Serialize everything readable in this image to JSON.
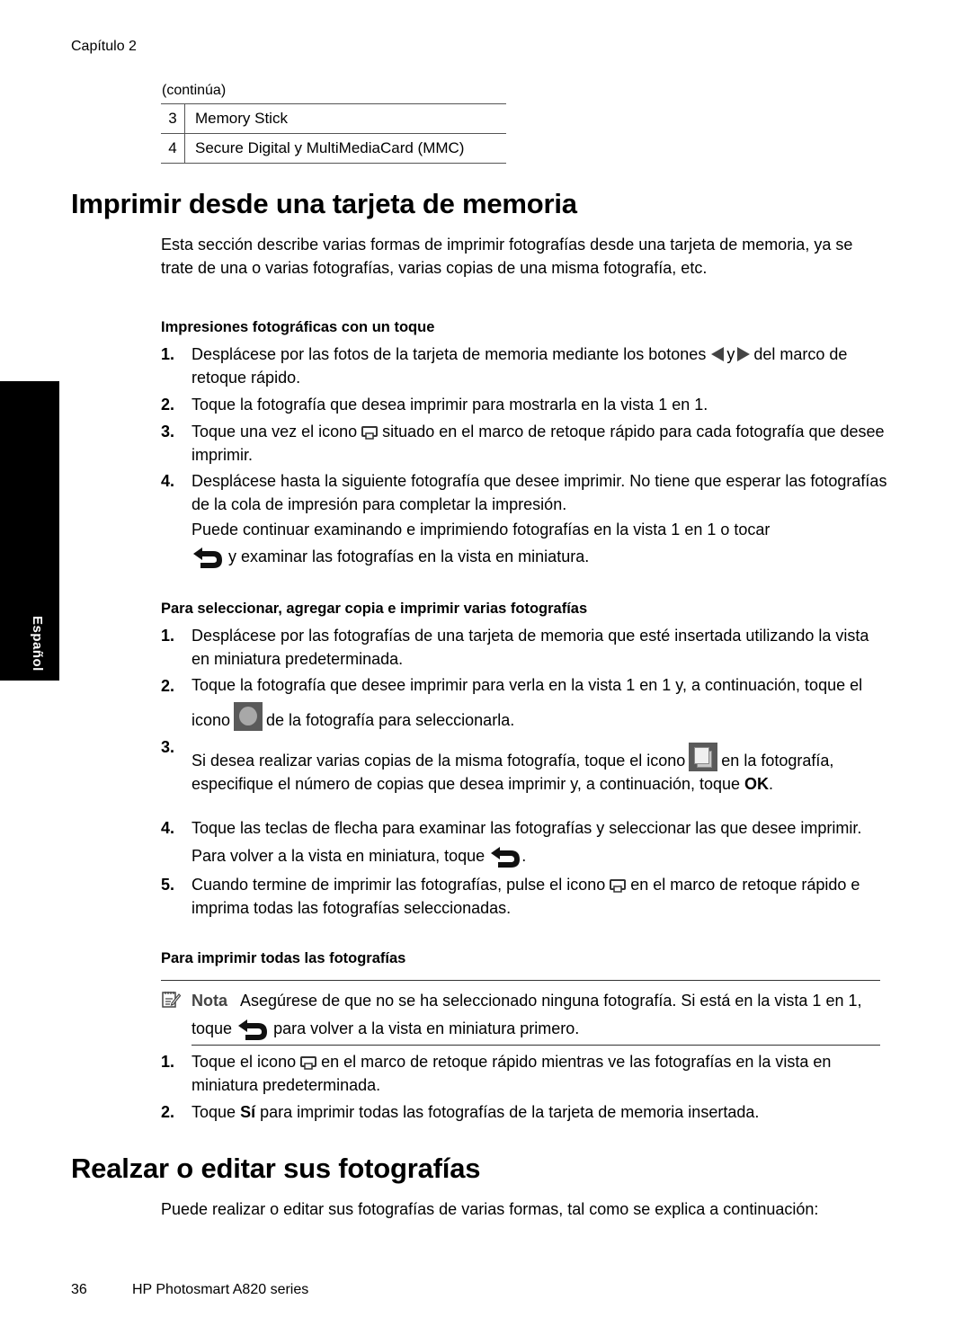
{
  "header": {
    "chapter": "Capítulo 2"
  },
  "table": {
    "continued_label": "(continúa)",
    "rows": [
      {
        "num": "3",
        "text": "Memory Stick"
      },
      {
        "num": "4",
        "text": "Secure Digital y MultiMediaCard (MMC)"
      }
    ]
  },
  "side_tab": {
    "label": "Español"
  },
  "section1": {
    "title": "Imprimir desde una tarjeta de memoria",
    "intro": "Esta sección describe varias formas de imprimir fotografías desde una tarjeta de memoria, ya se trate de una o varias fotografías, varias copias de una misma fotografía, etc.",
    "one_touch": {
      "heading": "Impresiones fotográficas con un toque",
      "steps": [
        {
          "num": "1.",
          "before": "Desplácese por las fotos de la tarjeta de memoria mediante los botones",
          "mid": "y",
          "after": "del marco de retoque rápido.",
          "icons": [
            "left-arrow-icon",
            "right-arrow-icon"
          ]
        },
        {
          "num": "2.",
          "text": "Toque la fotografía que desea imprimir para mostrarla en la vista 1 en 1."
        },
        {
          "num": "3.",
          "before": "Toque una vez el icono",
          "after": "situado en el marco de retoque rápido para cada fotografía que desee imprimir.",
          "icon": "print-icon"
        },
        {
          "num": "4.",
          "text": "Desplácese hasta la siguiente fotografía que desee imprimir. No tiene que esperar las fotografías de la cola de impresión para completar la impresión.",
          "extra_before": "Puede continuar examinando e imprimiendo fotografías en la vista 1 en 1 o tocar",
          "extra_after": "y examinar las fotografías en la vista en miniatura.",
          "icon": "back-icon"
        }
      ]
    },
    "multi": {
      "heading": "Para seleccionar, agregar copia e imprimir varias fotografías",
      "steps": [
        {
          "num": "1.",
          "text": "Desplácese por las fotografías de una tarjeta de memoria que esté insertada utilizando la vista en miniatura predeterminada."
        },
        {
          "num": "2.",
          "before": "Toque la fotografía que desee imprimir para verla en la vista 1 en 1 y, a continuación, toque el icono",
          "after": "de la fotografía para seleccionarla.",
          "icon": "select-icon"
        },
        {
          "num": "3.",
          "before": "Si desea realizar varias copias de la misma fotografía, toque el icono",
          "after": "en la fotografía, especifique el número de copias que desea imprimir y, a continuación, toque",
          "bold": "OK",
          "end": ".",
          "icon": "copies-icon"
        },
        {
          "num": "4.",
          "before": "Toque las teclas de flecha para examinar las fotografías y seleccionar las que desee imprimir. Para volver a la vista en miniatura, toque",
          "after": ".",
          "icon": "back-icon"
        },
        {
          "num": "5.",
          "before": "Cuando termine de imprimir las fotografías, pulse el icono",
          "after": "en el marco de retoque rápido e imprima todas las fotografías seleccionadas.",
          "icon": "print-icon"
        }
      ]
    },
    "all": {
      "heading": "Para imprimir todas las fotografías",
      "note": {
        "label": "Nota",
        "before": "Asegúrese de que no se ha seleccionado ninguna fotografía. Si está en la vista 1 en 1, toque",
        "after": "para volver a la vista en miniatura primero."
      },
      "steps": [
        {
          "num": "1.",
          "before": "Toque el icono",
          "after": "en el marco de retoque rápido mientras ve las fotografías en la vista en miniatura predeterminada.",
          "icon": "print-icon"
        },
        {
          "num": "2.",
          "before": "Toque",
          "bold": "Sí",
          "after": "para imprimir todas las fotografías de la tarjeta de memoria insertada."
        }
      ]
    }
  },
  "section2": {
    "title": "Realzar o editar sus fotografías",
    "intro": "Puede realizar o editar sus fotografías de varias formas, tal como se explica a continuación:"
  },
  "footer": {
    "page_number": "36",
    "product": "HP Photosmart A820 series"
  }
}
